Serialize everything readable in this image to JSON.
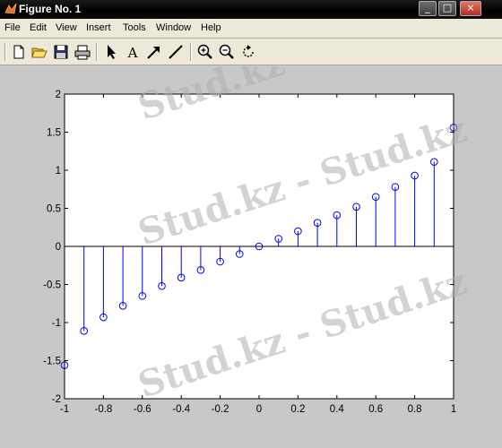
{
  "window": {
    "title": "Figure No. 1",
    "buttons": {
      "minimize": "_",
      "maximize": "□",
      "close": "×"
    }
  },
  "menu": [
    "File",
    "Edit",
    "View",
    "Insert",
    "Tools",
    "Window",
    "Help"
  ],
  "toolbar": {
    "buttons": [
      "new-figure-icon",
      "open-file-icon",
      "save-icon",
      "print-icon",
      "edit-plot-arrow-icon",
      "insert-text-icon",
      "insert-arrow-icon",
      "insert-line-icon",
      "zoom-in-icon",
      "zoom-out-icon",
      "rotate-3d-icon"
    ]
  },
  "watermark": {
    "text": "Stud.kz - Stud.kz",
    "color": "#b0b0b0"
  },
  "chart_data": {
    "type": "stem",
    "title": "",
    "xlabel": "",
    "ylabel": "",
    "xlim": [
      -1,
      1
    ],
    "ylim": [
      -2,
      2
    ],
    "xticks": [
      "-1",
      "-0.8",
      "-0.6",
      "-0.4",
      "-0.2",
      "0",
      "0.2",
      "0.4",
      "0.6",
      "0.8",
      "1"
    ],
    "yticks": [
      "2",
      "1.5",
      "1",
      "0.5",
      "0",
      "-0.5",
      "-1",
      "-1.5",
      "-2"
    ],
    "color": "#0000ff",
    "x": [
      -1,
      -0.9,
      -0.8,
      -0.7,
      -0.6,
      -0.5,
      -0.4,
      -0.3,
      -0.2,
      -0.1,
      0,
      0.1,
      0.2,
      0.3,
      0.4,
      0.5,
      0.6,
      0.7,
      0.8,
      0.9,
      1
    ],
    "y": [
      -1.56,
      -1.11,
      -0.93,
      -0.78,
      -0.65,
      -0.52,
      -0.41,
      -0.31,
      -0.2,
      -0.1,
      0,
      0.1,
      0.2,
      0.31,
      0.41,
      0.52,
      0.65,
      0.78,
      0.93,
      1.11,
      1.56
    ]
  }
}
